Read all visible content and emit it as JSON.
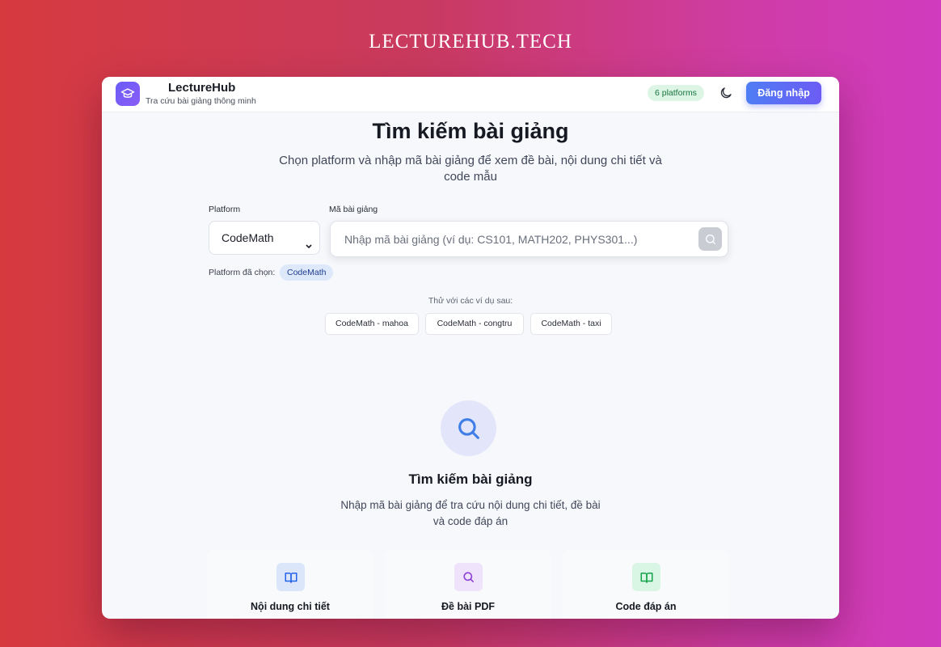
{
  "site_title": "LECTUREHUB.TECH",
  "header": {
    "brand_name": "LectureHub",
    "brand_subtitle": "Tra cứu bài giảng thông minh",
    "platforms_badge": "6 platforms",
    "login_label": "Đăng nhập",
    "theme_icon": "moon-icon",
    "logo_icon": "graduation-cap-icon"
  },
  "hero": {
    "title": "Tìm kiếm bài giảng",
    "subtitle": "Chọn platform và nhập mã bài giảng để xem đề bài, nội dung chi tiết và code mẫu"
  },
  "form": {
    "platform_label": "Platform",
    "platform_value": "CodeMath",
    "code_label": "Mã bài giảng",
    "code_placeholder": "Nhập mã bài giảng (ví dụ: CS101, MATH202, PHYS301...)",
    "code_value": "",
    "selected_label": "Platform đã chọn:",
    "selected_value": "CodeMath"
  },
  "examples": {
    "label": "Thử với các ví dụ sau:",
    "items": [
      "CodeMath - mahoa",
      "CodeMath - congtru",
      "CodeMath - taxi"
    ]
  },
  "empty_state": {
    "title": "Tìm kiếm bài giảng",
    "subtitle": "Nhập mã bài giảng để tra cứu nội dung chi tiết, đề bài và code đáp án"
  },
  "features": [
    {
      "label": "Nội dung chi tiết",
      "icon": "book-icon",
      "color": "#2563eb",
      "bg": "#dbe6fb"
    },
    {
      "label": "Đề bài PDF",
      "icon": "search-icon",
      "color": "#8b3fd6",
      "bg": "#efe2fb"
    },
    {
      "label": "Code đáp án",
      "icon": "book-icon",
      "color": "#16a34a",
      "bg": "#d9f6e4"
    }
  ],
  "colors": {
    "accent": "#5b6cf5",
    "badge_green": "#18753e",
    "chip_blue": "#1f3d8f"
  }
}
